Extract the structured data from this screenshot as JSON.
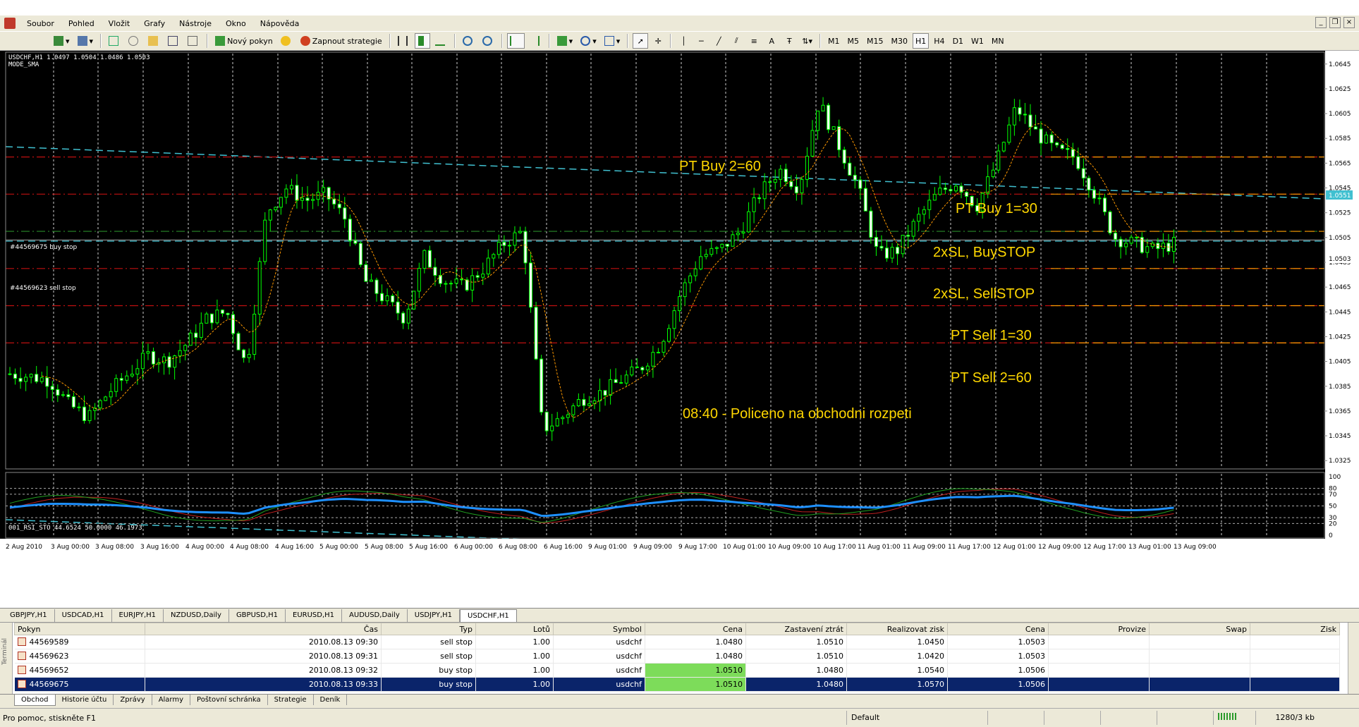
{
  "menu": [
    "Soubor",
    "Pohled",
    "Vložit",
    "Grafy",
    "Nástroje",
    "Okno",
    "Nápověda"
  ],
  "toolbar": {
    "new_order": "Nový pokyn",
    "auto_trading": "Zapnout strategie",
    "periods": [
      "M1",
      "M5",
      "M15",
      "M30",
      "H1",
      "H4",
      "D1",
      "W1",
      "MN"
    ],
    "active_period": "H1"
  },
  "chart": {
    "info_line": "USDCHF,H1  1.0497 1.0504 1.0486 1.0503",
    "indicator_label": "MODE_SMA",
    "sub_info": "001_RSI_STO 44.6524 50.0000 46.1973",
    "order_label_buy": "#44569675 buy stop",
    "order_label_sell": "#44569623 sell stop",
    "annotations": {
      "pt_buy2": "PT Buy 2=60",
      "pt_buy1": "PT Buy 1=30",
      "buystop": "2xSL, BuySTOP",
      "sellstop": "2xSL, SellSTOP",
      "pt_sell1": "PT Sell 1=30",
      "pt_sell2": "PT Sell 2=60",
      "note": "08:40 - Policeno na obchodni rozpeti"
    },
    "price_ticks": [
      "1.0645",
      "1.0625",
      "1.0605",
      "1.0585",
      "1.0565",
      "1.0545",
      "1.0525",
      "1.0505",
      "1.0485",
      "1.0465",
      "1.0445",
      "1.0425",
      "1.0405",
      "1.0385",
      "1.0365",
      "1.0345",
      "1.0325"
    ],
    "current_price": "1.0503",
    "level_price": "1.0551",
    "sub_ticks": [
      "100",
      "80",
      "70",
      "50",
      "30",
      "20",
      "0"
    ],
    "time_ticks": [
      "2 Aug 2010",
      "3 Aug 00:00",
      "3 Aug 08:00",
      "3 Aug 16:00",
      "4 Aug 00:00",
      "4 Aug 08:00",
      "4 Aug 16:00",
      "5 Aug 00:00",
      "5 Aug 08:00",
      "5 Aug 16:00",
      "6 Aug 00:00",
      "6 Aug 08:00",
      "6 Aug 16:00",
      "9 Aug 01:00",
      "9 Aug 09:00",
      "9 Aug 17:00",
      "10 Aug 01:00",
      "10 Aug 09:00",
      "10 Aug 17:00",
      "11 Aug 01:00",
      "11 Aug 09:00",
      "11 Aug 17:00",
      "12 Aug 01:00",
      "12 Aug 09:00",
      "12 Aug 17:00",
      "13 Aug 01:00",
      "13 Aug 09:00"
    ]
  },
  "chart_tabs": [
    "GBPJPY,H1",
    "USDCAD,H1",
    "EURJPY,H1",
    "NZDUSD,Daily",
    "GBPUSD,H1",
    "EURUSD,H1",
    "AUDUSD,Daily",
    "USDJPY,H1",
    "USDCHF,H1"
  ],
  "active_chart_tab": "USDCHF,H1",
  "orders": {
    "columns": [
      "Pokyn",
      "Čas",
      "Typ",
      "Lotů",
      "Symbol",
      "Cena",
      "Zastavení ztrát",
      "Realizovat zisk",
      "Cena",
      "Provize",
      "Swap",
      "Zisk"
    ],
    "rows": [
      {
        "id": "44569589",
        "time": "2010.08.13 09:30",
        "type": "sell stop",
        "lots": "1.00",
        "symbol": "usdchf",
        "price": "1.0480",
        "sl": "1.0510",
        "tp": "1.0450",
        "cur": "1.0503"
      },
      {
        "id": "44569623",
        "time": "2010.08.13 09:31",
        "type": "sell stop",
        "lots": "1.00",
        "symbol": "usdchf",
        "price": "1.0480",
        "sl": "1.0510",
        "tp": "1.0420",
        "cur": "1.0503"
      },
      {
        "id": "44569652",
        "time": "2010.08.13 09:32",
        "type": "buy stop",
        "lots": "1.00",
        "symbol": "usdchf",
        "price": "1.0510",
        "sl": "1.0480",
        "tp": "1.0540",
        "cur": "1.0506"
      },
      {
        "id": "44569675",
        "time": "2010.08.13 09:33",
        "type": "buy stop",
        "lots": "1.00",
        "symbol": "usdchf",
        "price": "1.0510",
        "sl": "1.0480",
        "tp": "1.0570",
        "cur": "1.0506"
      }
    ]
  },
  "terminal_side_label": "Terminál",
  "bottom_tabs": [
    "Obchod",
    "Historie účtu",
    "Zprávy",
    "Alarmy",
    "Poštovní schránka",
    "Strategie",
    "Deník"
  ],
  "active_bottom_tab": "Obchod",
  "status": {
    "help": "Pro pomoc, stiskněte F1",
    "profile": "Default",
    "traffic": "1280/3 kb"
  },
  "colors": {
    "bull_candle": "#00ff00",
    "annotation": "#ffd700",
    "channel": "#40c0d0",
    "level_red": "#c01010",
    "level_orange": "#ff9900",
    "rsi_main": "#1e90ff"
  }
}
